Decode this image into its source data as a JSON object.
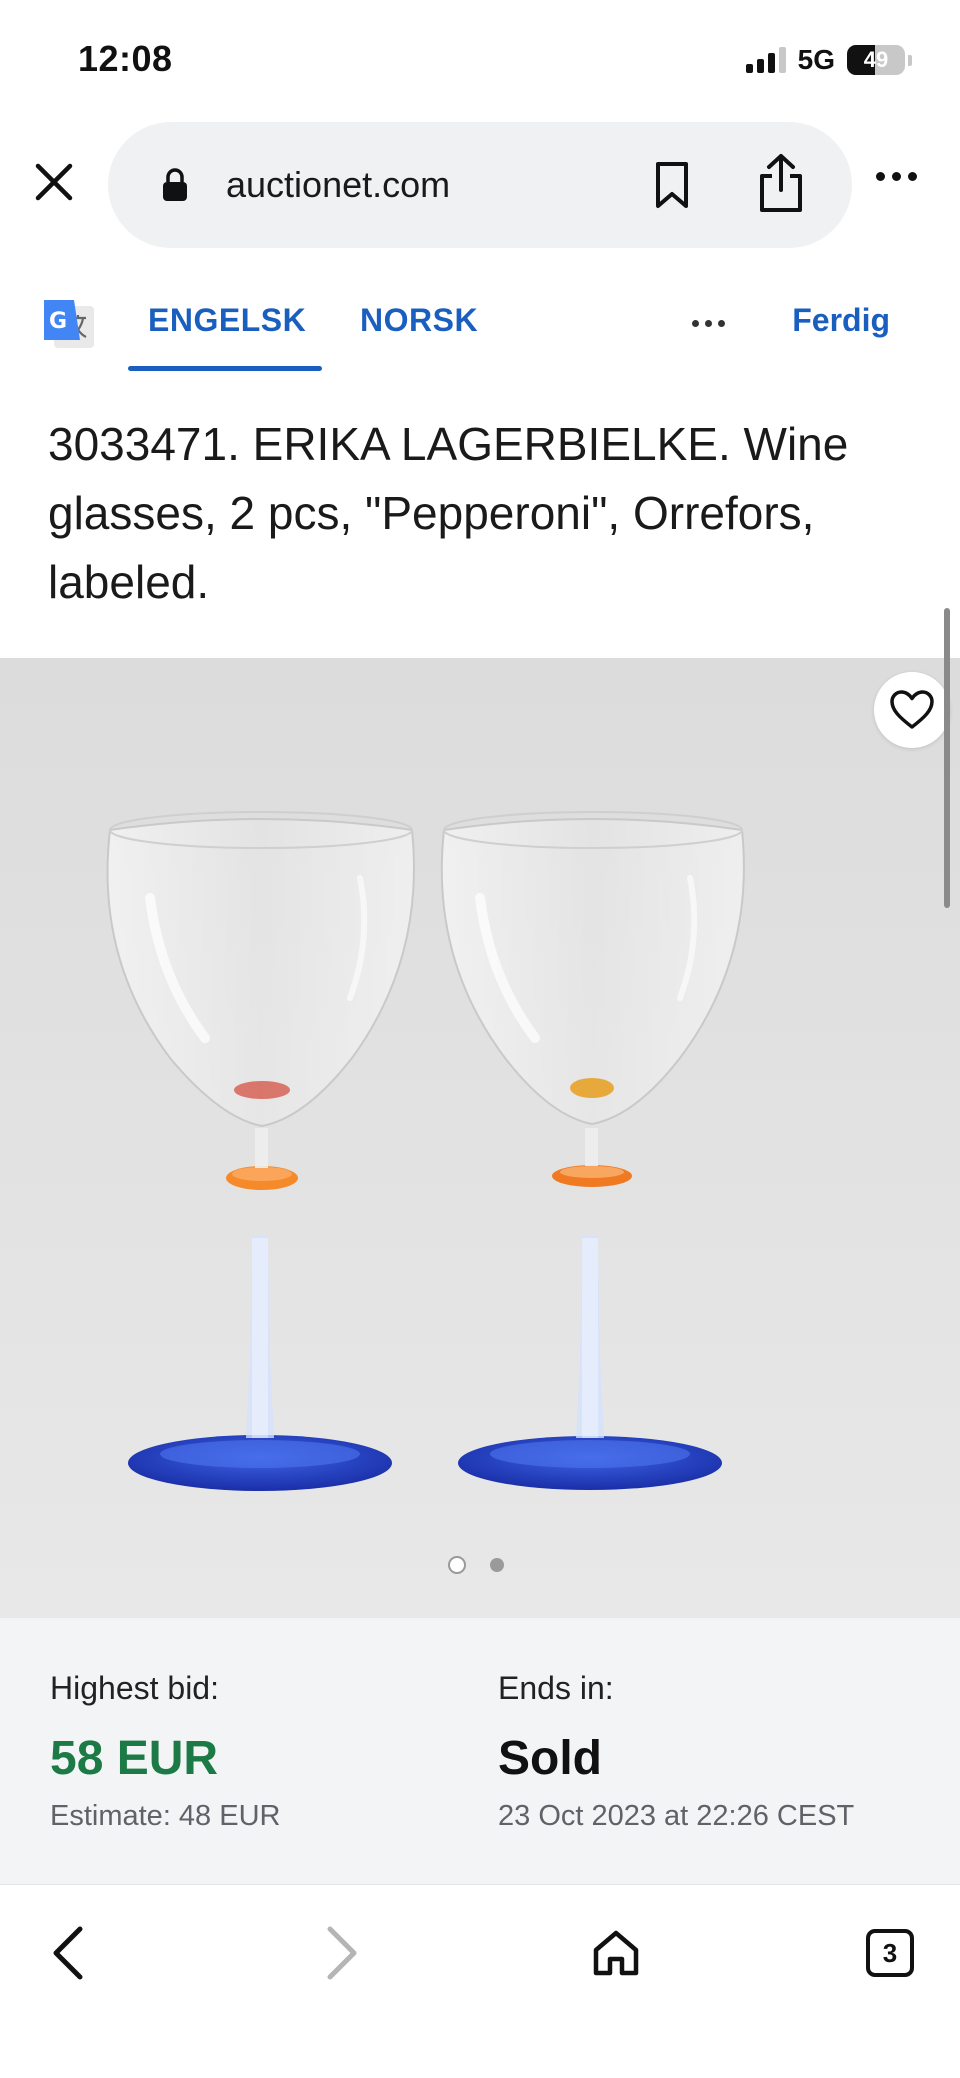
{
  "status_bar": {
    "time": "12:08",
    "network": "5G",
    "battery": "49",
    "battery_level": 0.49
  },
  "address_bar": {
    "url": "auctionet.com",
    "icons": [
      "close-icon",
      "lock-icon",
      "bookmark-icon",
      "share-icon",
      "more-icon"
    ]
  },
  "translate_bar": {
    "tab_english": "ENGELSK",
    "tab_norwegian": "NORSK",
    "done_label": "Ferdig",
    "active_tab": "ENGELSK"
  },
  "lot": {
    "title": "3033471. ERIKA LAGERBIELKE. Wine glasses, 2 pcs, \"Pepperoni\", Orrefors, labeled.",
    "image_count": 2,
    "active_image": 1
  },
  "bid_panel": {
    "highest_bid_label": "Highest bid:",
    "highest_bid_value": "58 EUR",
    "estimate": "Estimate: 48 EUR",
    "ends_in_label": "Ends in:",
    "ends_in_value": "Sold",
    "end_date": "23 Oct 2023 at 22:26 CEST"
  },
  "bottom_nav": {
    "tab_count": "3",
    "icons": [
      "back-icon",
      "forward-icon",
      "home-icon",
      "tabs-icon"
    ]
  },
  "colors": {
    "accent": "#1a5fbf",
    "bid_green": "#1b7a45",
    "panel_bg": "#f3f4f6",
    "image_bg": "#e1e1e1",
    "glass_foot_blue": "#1d3fc2",
    "glass_disc_orange": "#f07a22"
  }
}
